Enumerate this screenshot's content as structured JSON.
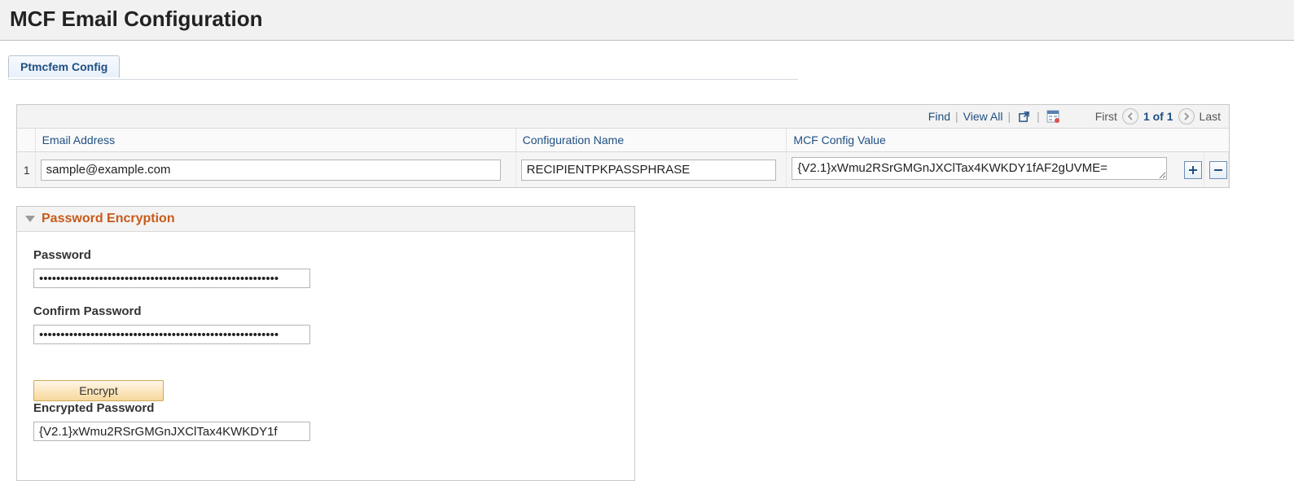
{
  "header": {
    "title": "MCF Email Configuration"
  },
  "tabs": {
    "active": "Ptmcfem Config"
  },
  "grid": {
    "toolbar": {
      "find": "Find",
      "view_all": "View All",
      "first": "First",
      "last": "Last",
      "position": "1 of 1"
    },
    "columns": {
      "email": "Email Address",
      "config_name": "Configuration Name",
      "config_value": "MCF Config Value"
    },
    "rows": [
      {
        "num": "1",
        "email": "sample@example.com",
        "config_name": "RECIPIENTPKPASSPHRASE",
        "config_value": "{V2.1}xWmu2RSrGMGnJXClTax4KWKDY1fAF2gUVME="
      }
    ]
  },
  "panel": {
    "title": "Password Encryption",
    "labels": {
      "password": "Password",
      "confirm": "Confirm Password",
      "encrypted": "Encrypted Password",
      "encrypt_btn": "Encrypt"
    },
    "values": {
      "password": "••••••••••••••••••••••••••••••••••••••••••••••••••••••••",
      "confirm": "••••••••••••••••••••••••••••••••••••••••••••••••••••••••",
      "encrypted": "{V2.1}xWmu2RSrGMGnJXClTax4KWKDY1f"
    }
  }
}
